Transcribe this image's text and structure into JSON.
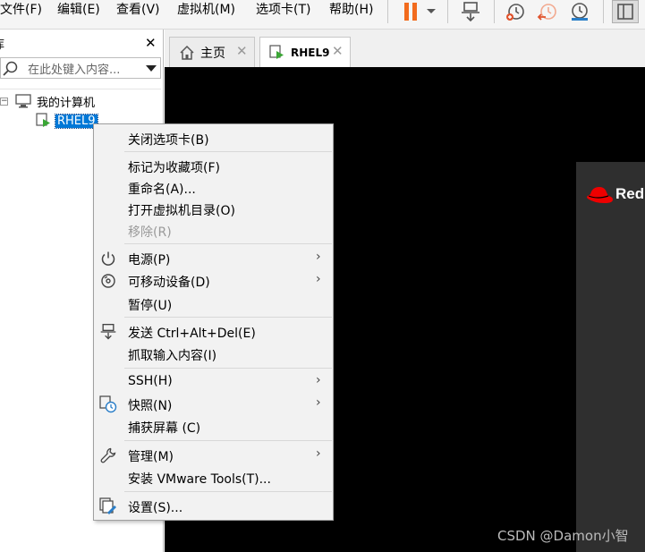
{
  "menubar": {
    "items": [
      "文件(F)",
      "编辑(E)",
      "查看(V)",
      "虚拟机(M)",
      "选项卡(T)",
      "帮助(H)"
    ]
  },
  "toolbar": {
    "icons": [
      "pause-icon",
      "dropdown-arrow-icon",
      "send-keys-icon",
      "snapshot-take-icon",
      "snapshot-revert-icon",
      "snapshot-manager-icon",
      "library-view-icon"
    ]
  },
  "library": {
    "title": "库",
    "search_placeholder": "在此处键入内容...",
    "tree": {
      "root_label": "我的计算机",
      "child_label": "RHEL9"
    }
  },
  "tabs": [
    {
      "label": "主页"
    },
    {
      "label": "RHEL9"
    }
  ],
  "console": {
    "brand_text": "Red",
    "watermark": "CSDN @Damon小智"
  },
  "context_menu": {
    "items": {
      "close_tab": "关闭选项卡(B)",
      "mark_favorite": "标记为收藏项(F)",
      "rename": "重命名(A)...",
      "open_vm_dir": "打开虚拟机目录(O)",
      "remove": "移除(R)",
      "power": "电源(P)",
      "removable_devices": "可移动设备(D)",
      "pause": "暂停(U)",
      "send_cad": "发送 Ctrl+Alt+Del(E)",
      "grab_input": "抓取输入内容(I)",
      "ssh": "SSH(H)",
      "snapshot": "快照(N)",
      "capture_screen": "捕获屏幕 (C)",
      "manage": "管理(M)",
      "install_tools": "安装 VMware Tools(T)...",
      "settings": "设置(S)..."
    }
  },
  "colors": {
    "selection": "#0078d7",
    "pause_orange": "#f26b1d",
    "redhat_red": "#ee0000",
    "console_bg": "#000000",
    "installer_panel": "#2f2f2f"
  }
}
